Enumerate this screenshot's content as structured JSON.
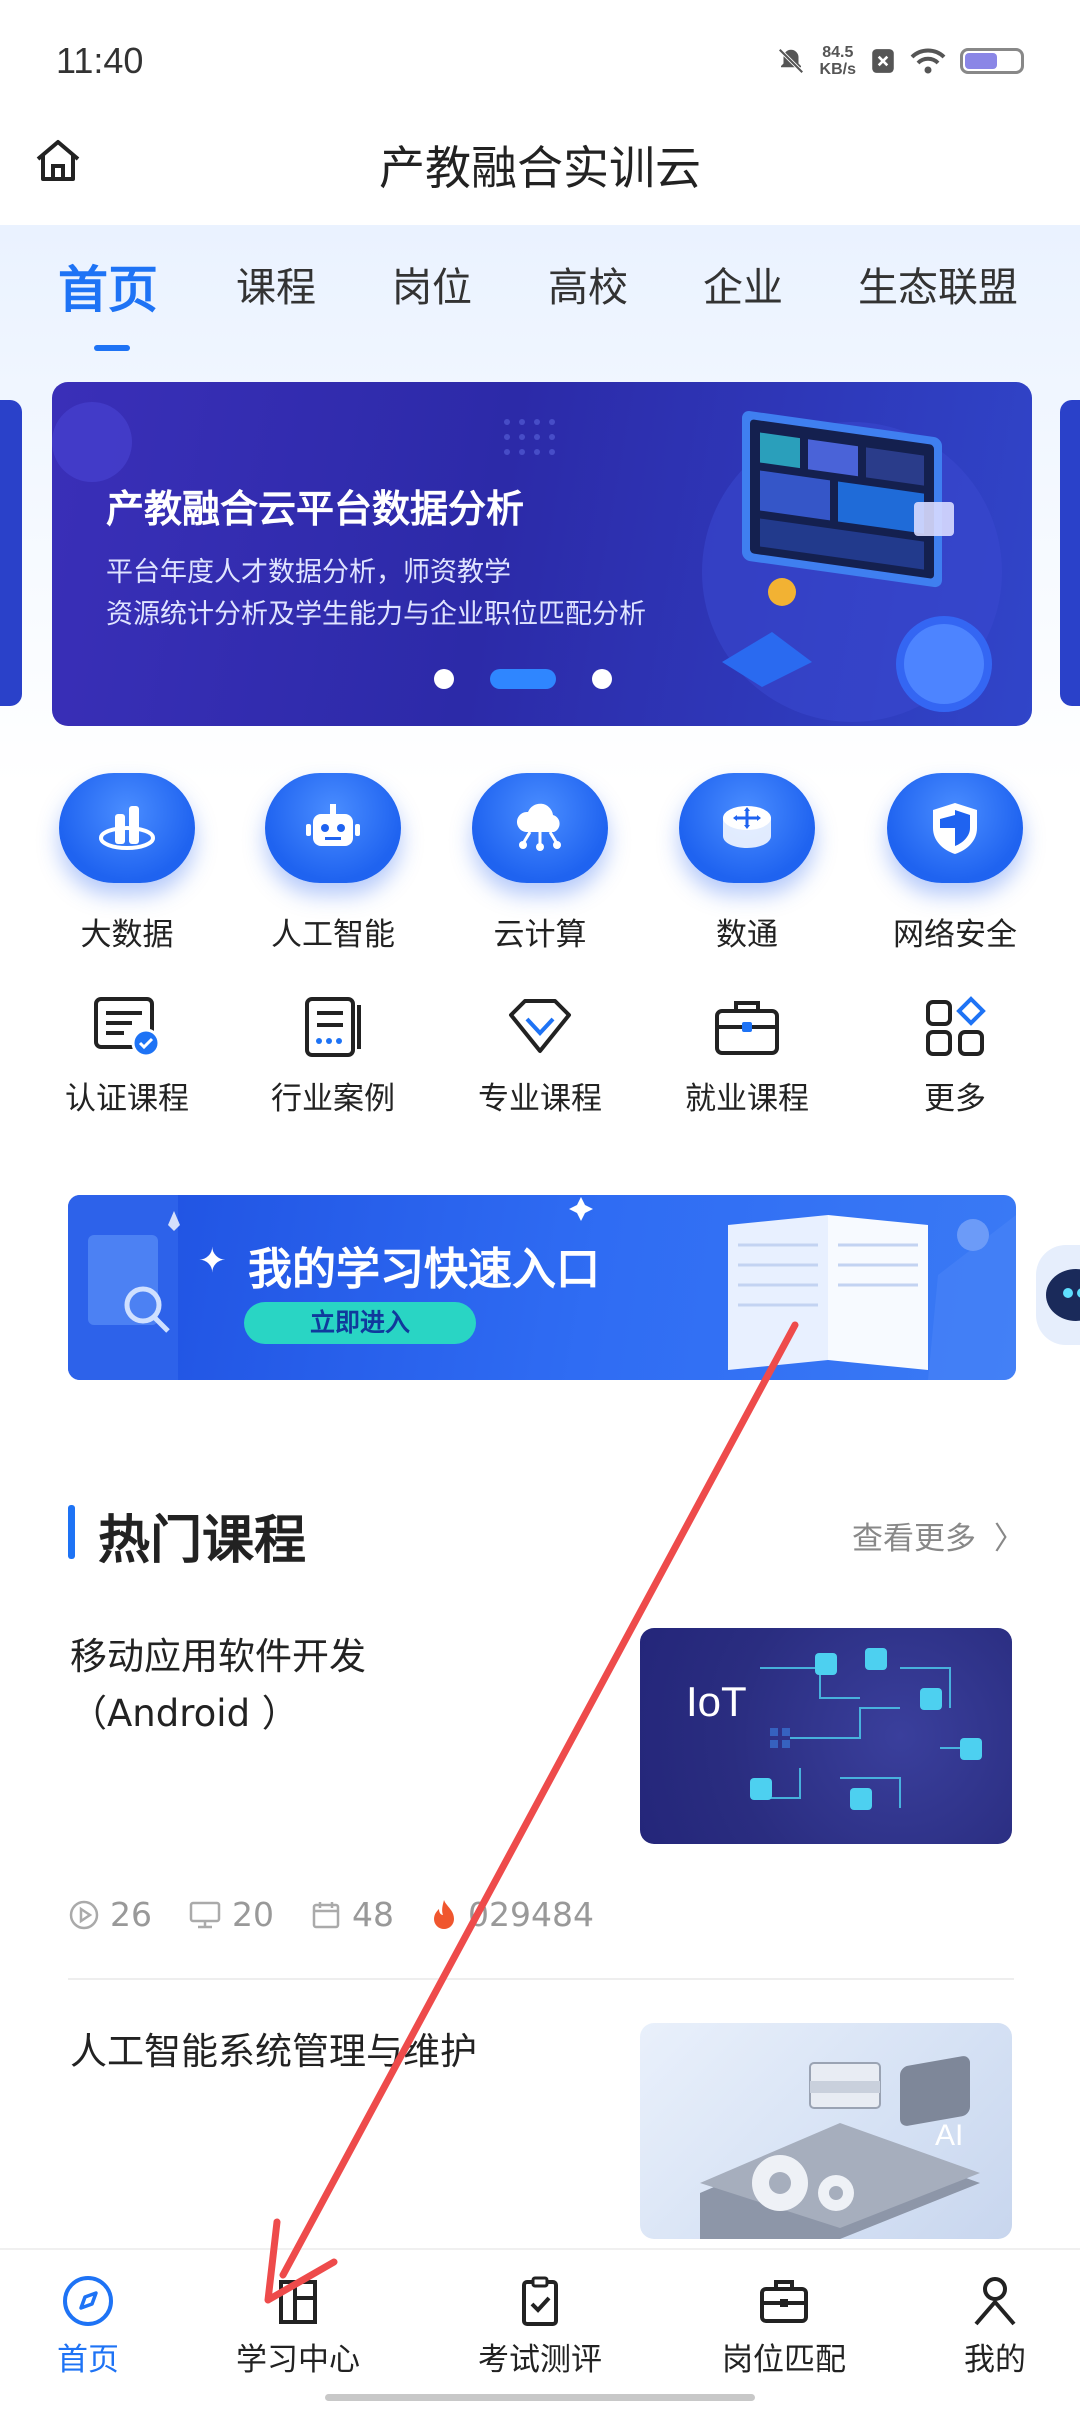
{
  "status_bar": {
    "time": "11:40",
    "net_speed_value": "84.5",
    "net_speed_unit": "KB/s",
    "battery_level": 0.62
  },
  "header": {
    "title": "产教融合实训云",
    "home_icon": "home-icon"
  },
  "tabs": [
    {
      "label": "首页",
      "active": true
    },
    {
      "label": "课程",
      "active": false
    },
    {
      "label": "岗位",
      "active": false
    },
    {
      "label": "高校",
      "active": false
    },
    {
      "label": "企业",
      "active": false
    },
    {
      "label": "生态联盟",
      "active": false
    }
  ],
  "banner": {
    "title": "产教融合云平台数据分析",
    "subtitle_line1": "平台年度人才数据分析，师资教学",
    "subtitle_line2": "资源统计分析及学生能力与企业职位匹配分析",
    "active_index": 1,
    "count": 3
  },
  "categories": [
    {
      "label": "大数据",
      "icon": "big-data-icon"
    },
    {
      "label": "人工智能",
      "icon": "robot-icon"
    },
    {
      "label": "云计算",
      "icon": "cloud-icon"
    },
    {
      "label": "数通",
      "icon": "network-router-icon"
    },
    {
      "label": "网络安全",
      "icon": "shield-icon"
    }
  ],
  "shortcuts": [
    {
      "label": "认证课程",
      "icon": "certificate-icon"
    },
    {
      "label": "行业案例",
      "icon": "document-list-icon"
    },
    {
      "label": "专业课程",
      "icon": "diamond-icon"
    },
    {
      "label": "就业课程",
      "icon": "briefcase-icon"
    },
    {
      "label": "更多",
      "icon": "grid-more-icon"
    }
  ],
  "quick_entry": {
    "title": "我的学习快速入口",
    "button": "立即进入"
  },
  "hot": {
    "title": "热门课程",
    "more": "查看更多"
  },
  "courses": [
    {
      "title_line1": "移动应用软件开发",
      "title_line2": "（Android ）",
      "thumb_text": "IoT",
      "stats": {
        "videos": "26",
        "lessons": "20",
        "days": "48",
        "heat": "029484"
      }
    },
    {
      "title_line1": "人工智能系统管理与维护",
      "thumb_text": "AI"
    }
  ],
  "bottom_nav": [
    {
      "label": "首页",
      "active": true
    },
    {
      "label": "学习中心",
      "active": false
    },
    {
      "label": "考试测评",
      "active": false
    },
    {
      "label": "岗位匹配",
      "active": false
    },
    {
      "label": "我的",
      "active": false
    }
  ],
  "colors": {
    "accent": "#1e73f5",
    "arrow": "#ee4b4b",
    "banner": "#2c2aa8"
  }
}
